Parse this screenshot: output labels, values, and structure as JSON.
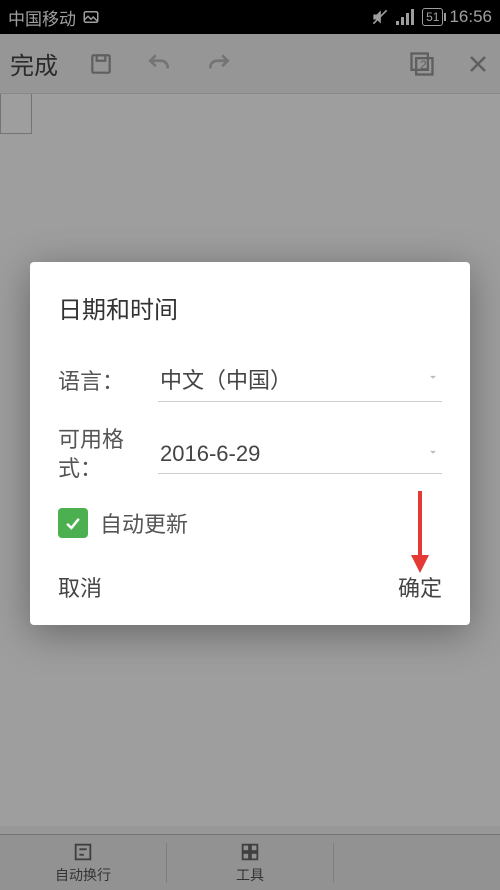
{
  "status": {
    "carrier": "中国移动",
    "battery": "51",
    "time": "16:56"
  },
  "toolbar": {
    "done": "完成",
    "layers_count": "2"
  },
  "bottom": {
    "wrap": "自动换行",
    "tools": "工具"
  },
  "dialog": {
    "title": "日期和时间",
    "language_label": "语言：",
    "language_value": "中文（中国）",
    "format_label": "可用格式：",
    "format_value": "2016-6-29",
    "auto_update_label": "自动更新",
    "cancel": "取消",
    "confirm": "确定"
  },
  "colors": {
    "accent": "#4caf50",
    "arrow": "#e53935"
  }
}
